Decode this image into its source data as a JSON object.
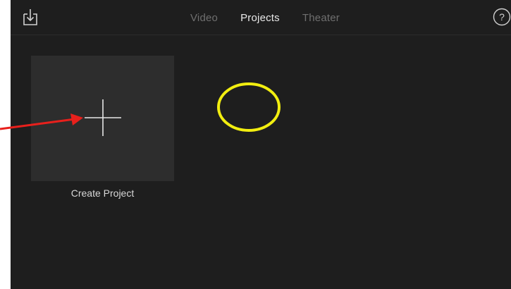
{
  "toolbar": {
    "import_icon": "import-tray-icon",
    "help_icon": "question-circle-icon",
    "help_glyph": "?"
  },
  "tabs": [
    {
      "label": "Video",
      "active": false
    },
    {
      "label": "Projects",
      "active": true
    },
    {
      "label": "Theater",
      "active": false
    }
  ],
  "main": {
    "create_project_label": "Create Project",
    "create_icon": "plus-icon"
  },
  "annotations": {
    "arrow_color": "#e8201c",
    "circle_color": "#f2ee10"
  },
  "colors": {
    "background": "#1e1e1e",
    "tile": "#2d2d2d",
    "active_tab": "#e8e8e8",
    "inactive_tab": "#6f6f6f"
  }
}
